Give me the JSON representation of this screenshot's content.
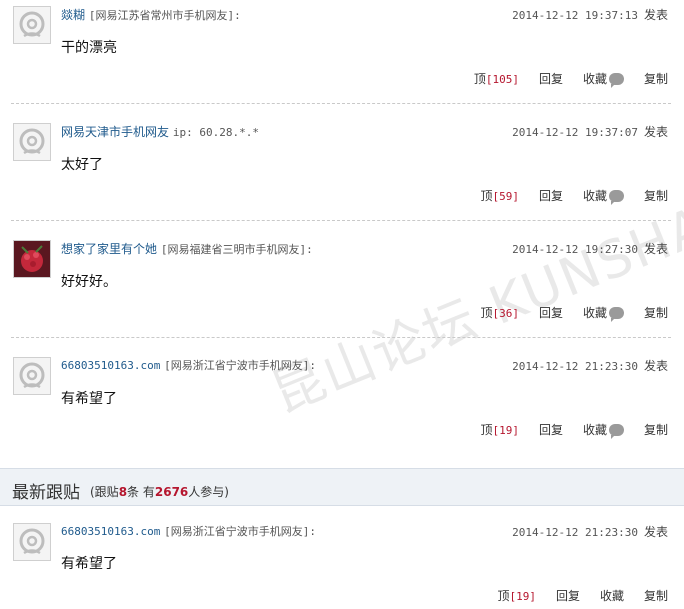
{
  "posts": [
    {
      "user": "燚糊",
      "location": "[网易江苏省常州市手机网友]:",
      "time": "2014-12-12 19:37:13",
      "publish": "发表",
      "content": "干的漂亮",
      "up_label": "顶",
      "up_count": "[105]",
      "reply": "回复",
      "fav": "收藏",
      "copy": "复制",
      "avatar": "default"
    },
    {
      "user": "网易天津市手机网友",
      "location": "ip: 60.28.*.*",
      "time": "2014-12-12 19:37:07",
      "publish": "发表",
      "content": "太好了",
      "up_label": "顶",
      "up_count": "[59]",
      "reply": "回复",
      "fav": "收藏",
      "copy": "复制",
      "avatar": "default"
    },
    {
      "user": "想家了家里有个她",
      "location": "[网易福建省三明市手机网友]:",
      "time": "2014-12-12 19:27:30",
      "publish": "发表",
      "content": "好好好。",
      "up_label": "顶",
      "up_count": "[36]",
      "reply": "回复",
      "fav": "收藏",
      "copy": "复制",
      "avatar": "photo"
    },
    {
      "user": "66803510163.com",
      "location": "[网易浙江省宁波市手机网友]:",
      "time": "2014-12-12 21:23:30",
      "publish": "发表",
      "content": "有希望了",
      "up_label": "顶",
      "up_count": "[19]",
      "reply": "回复",
      "fav": "收藏",
      "copy": "复制",
      "avatar": "default"
    }
  ],
  "latest": {
    "title": "最新跟贴",
    "stats_prefix": "(跟贴",
    "post_count": "8",
    "stats_mid": "条 有",
    "participants": "2676",
    "stats_suffix": "人参与)"
  },
  "latest_post": {
    "user": "66803510163.com",
    "location": "[网易浙江省宁波市手机网友]:",
    "time": "2014-12-12 21:23:30",
    "publish": "发表",
    "content": "有希望了",
    "up_label": "顶",
    "up_count": "[19]",
    "reply": "回复",
    "fav": "收藏",
    "copy": "复制"
  },
  "watermark": "昆山论坛 KUNSHAN BBS"
}
